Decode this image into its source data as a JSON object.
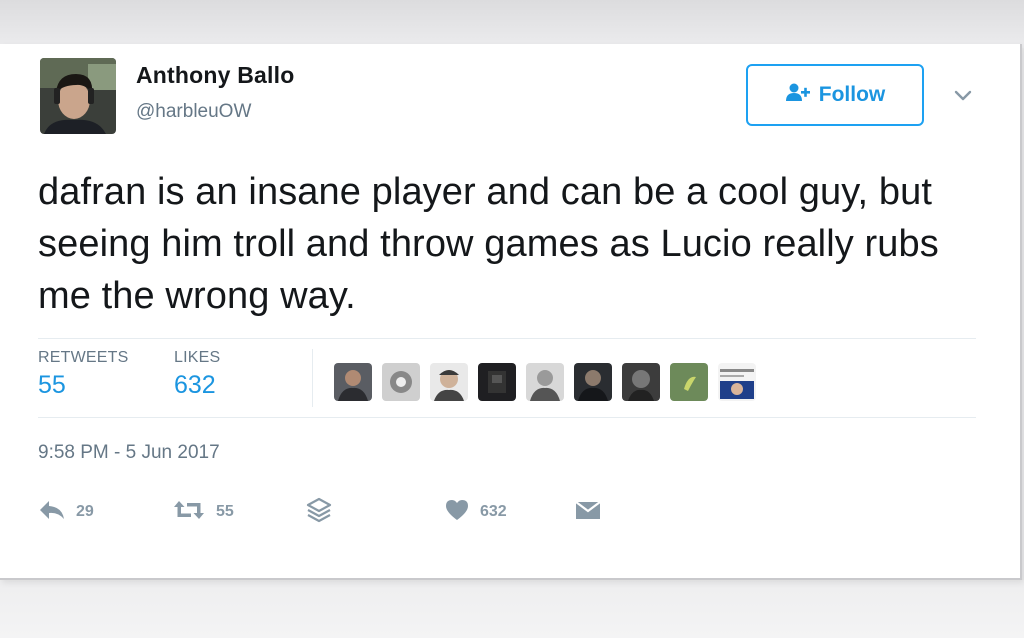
{
  "author": {
    "name": "Anthony Ballo",
    "handle": "@harbleuOW"
  },
  "follow_button": {
    "label": "Follow",
    "icon": "add-user-icon"
  },
  "menu": {
    "icon": "chevron-down-icon"
  },
  "tweet": {
    "text": "dafran is an insane player and can be a cool guy, but seeing him troll and throw games as Lucio really rubs me the wrong way.",
    "timestamp": "9:58 PM - 5 Jun 2017"
  },
  "stats": {
    "retweets_label": "RETWEETS",
    "retweets_value": "55",
    "likes_label": "LIKES",
    "likes_value": "632"
  },
  "likers": [
    {
      "icon": "user-avatar"
    },
    {
      "icon": "user-avatar"
    },
    {
      "icon": "user-avatar"
    },
    {
      "icon": "user-avatar"
    },
    {
      "icon": "user-avatar"
    },
    {
      "icon": "user-avatar"
    },
    {
      "icon": "user-avatar"
    },
    {
      "icon": "user-avatar"
    },
    {
      "icon": "user-avatar"
    }
  ],
  "actions": {
    "reply_count": "29",
    "retweet_count": "55",
    "like_count": "632"
  },
  "colors": {
    "accent": "#1da1f2",
    "text": "#14171a",
    "muted": "#657786"
  }
}
